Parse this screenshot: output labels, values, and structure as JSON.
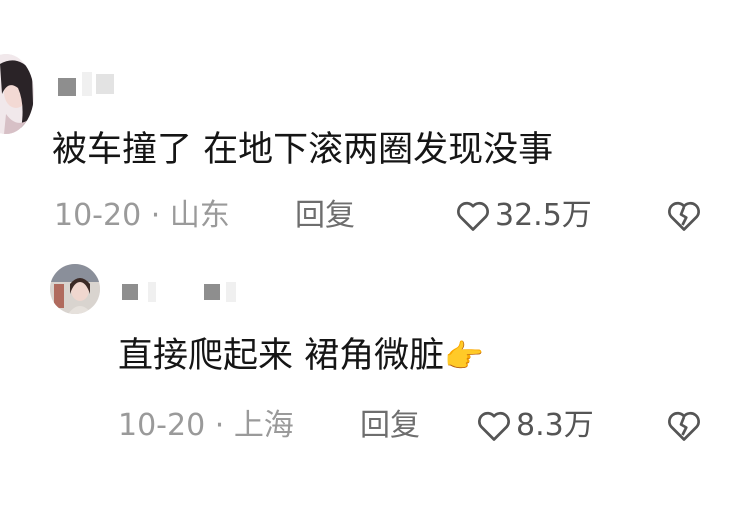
{
  "comments": [
    {
      "text": "被车撞了 在地下滚两圈发现没事",
      "date": "10-20",
      "location": "山东",
      "reply_label": "回复",
      "likes": "32.5万"
    },
    {
      "text": "直接爬起来 裙角微脏",
      "emoji": "👉",
      "date": "10-20",
      "location": "上海",
      "reply_label": "回复",
      "likes": "8.3万"
    }
  ],
  "icons": {
    "like": "heart-outline-icon",
    "dislike": "broken-heart-icon"
  },
  "colors": {
    "text": "#151515",
    "meta": "#9a9a9a",
    "icon": "#555555"
  }
}
